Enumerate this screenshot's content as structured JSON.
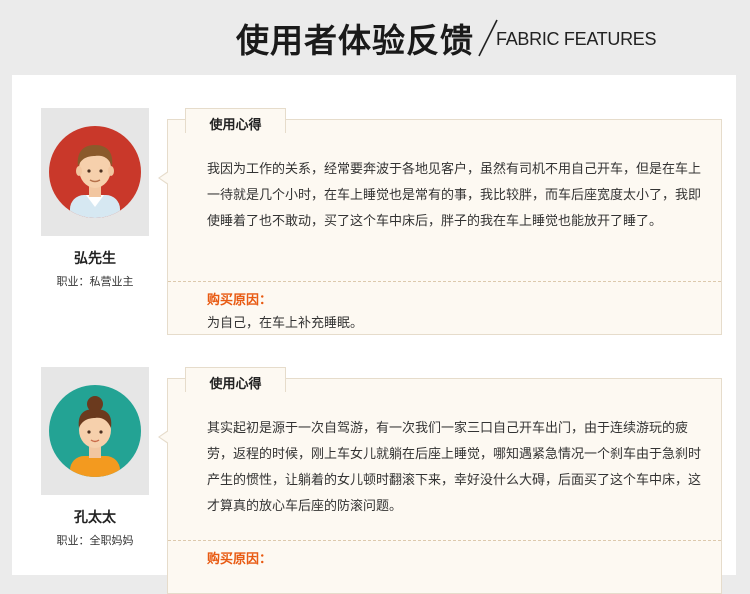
{
  "header": {
    "title": "使用者体验反馈",
    "subtitle": "FABRIC FEATURES"
  },
  "colors": {
    "accent_orange": "#e85a12",
    "card_bg": "#fdf9f2",
    "card_border": "#e6dccb"
  },
  "testimonials": [
    {
      "avatar": "man-avatar-icon",
      "name": "弘先生",
      "job": "职业：私营业主",
      "tab": "使用心得",
      "body": "我因为工作的关系，经常要奔波于各地见客户，虽然有司机不用自己开车，但是在车上一待就是几个小时，在车上睡觉也是常有的事，我比较胖，而车后座宽度太小了，我即使睡着了也不敢动，买了这个车中床后，胖子的我在车上睡觉也能放开了睡了。",
      "reason_label": "购买原因：",
      "reason": "为自己，在车上补充睡眠。"
    },
    {
      "avatar": "woman-avatar-icon",
      "name": "孔太太",
      "job": "职业：全职妈妈",
      "tab": "使用心得",
      "body": "其实起初是源于一次自驾游，有一次我们一家三口自己开车出门，由于连续游玩的疲劳，返程的时候，刚上车女儿就躺在后座上睡觉，哪知遇紧急情况一个刹车由于急刹时产生的惯性，让躺着的女儿顿时翻滚下来，幸好没什么大碍，后面买了这个车中床，这才算真的放心车后座的防滚问题。",
      "reason_label": "购买原因：",
      "reason": ""
    }
  ]
}
